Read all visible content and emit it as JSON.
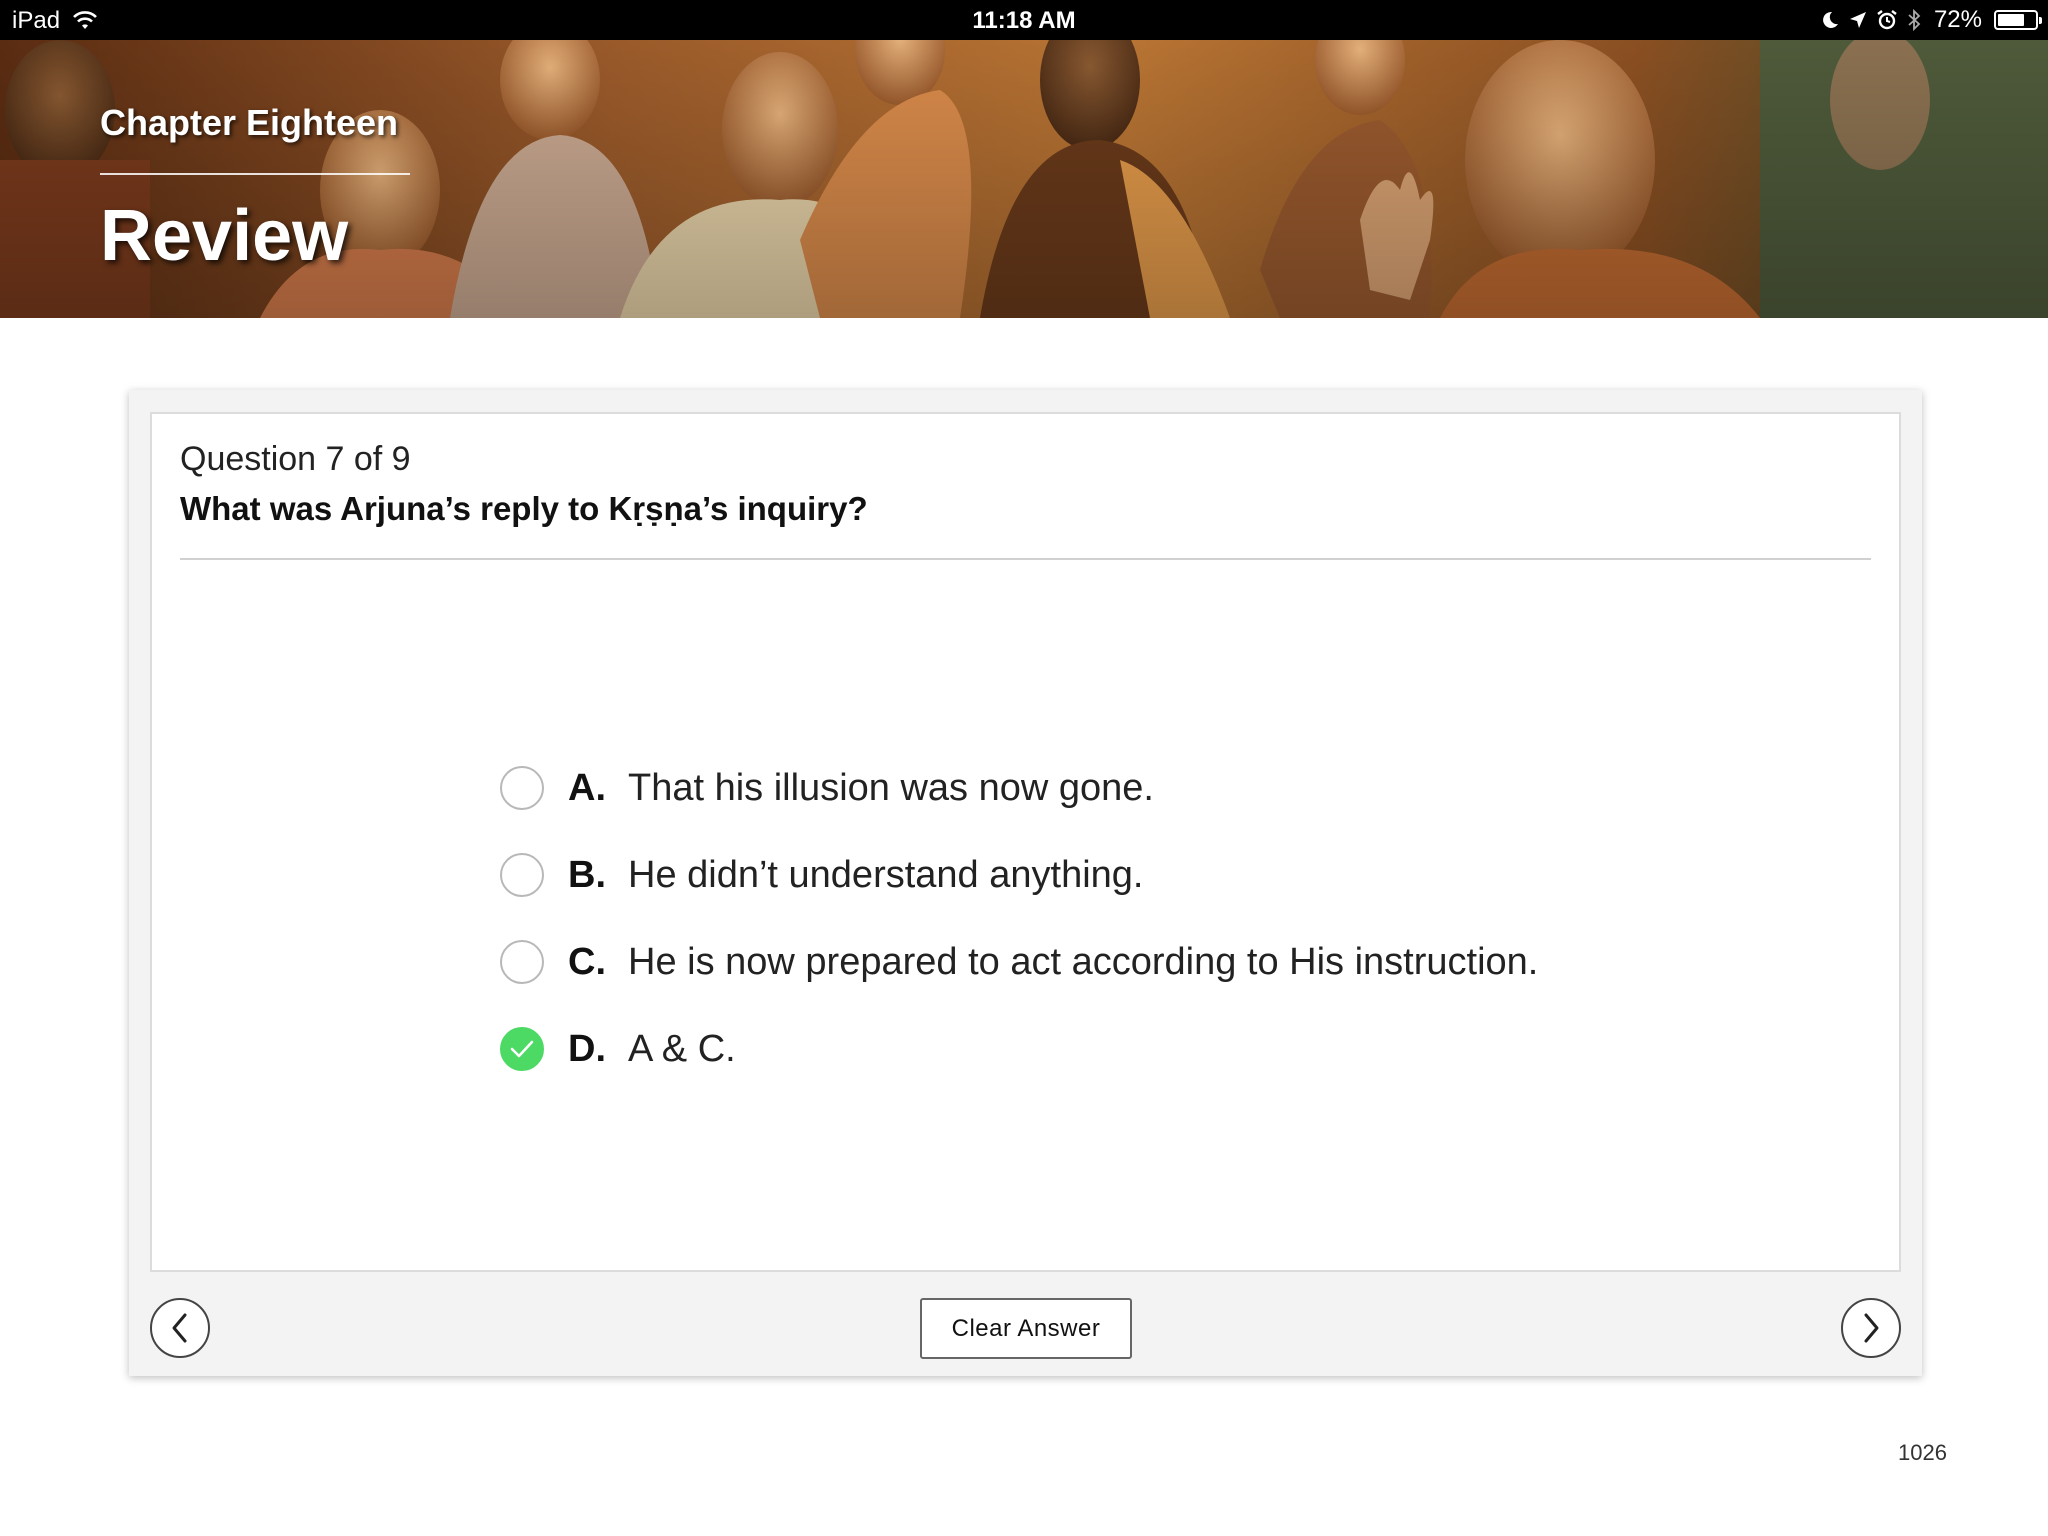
{
  "status_bar": {
    "device": "iPad",
    "time": "11:18 AM",
    "battery_percent": "72%",
    "battery_level": 0.72,
    "icons": [
      "wifi-icon",
      "moon-icon",
      "location-arrow-icon",
      "alarm-icon",
      "bluetooth-icon",
      "battery-icon"
    ]
  },
  "hero": {
    "chapter": "Chapter Eighteen",
    "title": "Review"
  },
  "quiz": {
    "question_count": "Question 7 of 9",
    "question": "What was Arjuna’s reply to Kṛṣṇa’s inquiry?",
    "options": [
      {
        "letter": "A.",
        "text": "That his illusion was now gone.",
        "selected": false
      },
      {
        "letter": "B.",
        "text": "He didn’t understand anything.",
        "selected": false
      },
      {
        "letter": "C.",
        "text": "He is now prepared to act according to His instruction.",
        "selected": false
      },
      {
        "letter": "D.",
        "text": "A & C.",
        "selected": true
      }
    ],
    "clear_label": "Clear Answer",
    "prev_icon": "chevron-left-icon",
    "next_icon": "chevron-right-icon"
  },
  "page_number": "1026",
  "colors": {
    "selected": "#4cd964",
    "status_bar": "#000000",
    "panel_bg": "#f3f3f3"
  }
}
